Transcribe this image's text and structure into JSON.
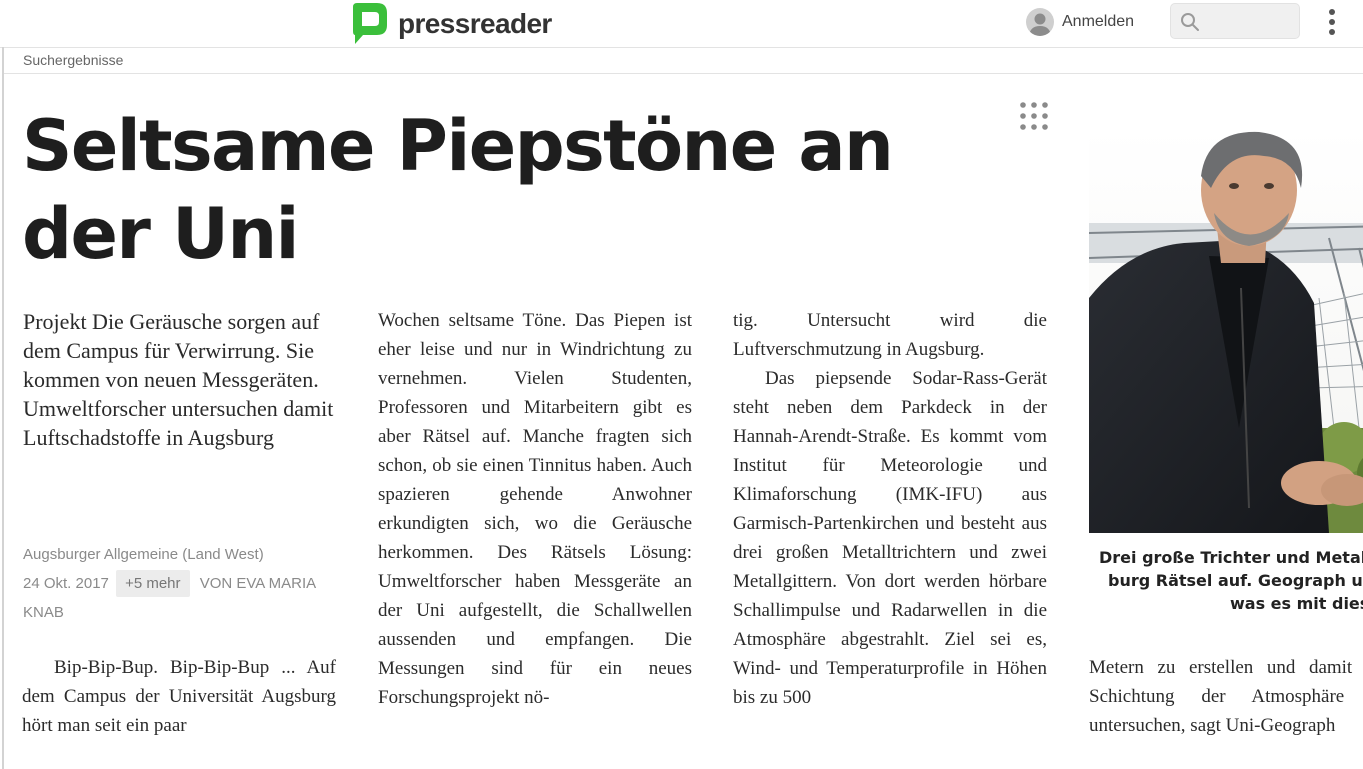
{
  "header": {
    "logo_text": "pressreader",
    "brand_color": "#3bbf3b",
    "signin_label": "Anmelden",
    "search_placeholder": ""
  },
  "breadcrumb": "Suchergebnisse",
  "article": {
    "headline": "Seltsame Piepstöne an der Uni",
    "lead": "Projekt Die Geräusche sorgen auf dem Campus für Verwirrung. Sie kommen von neuen Messgeräten. Umweltforscher untersuchen damit Luftschadstoffe in Augsburg",
    "publication": "Augsburger Allgemeine (Land West)",
    "date": "24 Okt. 2017",
    "more_label": "+5 mehr",
    "byline": "VON EVA MARIA KNAB",
    "col1": "Bip-Bip-Bup. Bip-Bip-Bup ... Auf dem Campus der Universität Augsburg hört man seit ein paar",
    "col2": "Wochen seltsame Töne. Das Piepen ist eher leise und nur in Windrichtung zu vernehmen. Vielen Studenten, Professoren und Mitarbeitern gibt es aber Rätsel auf. Manche fragten sich schon, ob sie einen Tinnitus haben. Auch spazieren gehende Anwohner erkundigten sich, wo die Geräusche herkommen. Des Rätsels Lösung: Umweltforscher haben Messgeräte an der Uni aufgestellt, die Schallwellen aussenden und empfangen. Die Messungen sind für ein neues Forschungsprojekt nö-",
    "col3_p1": "tig. Untersucht wird die Luftverschmutzung in Augsburg.",
    "col3_p2": "Das piepsende Sodar-Rass-Gerät steht neben dem Parkdeck in der Hannah-Arendt-Straße. Es kommt vom Institut für Meteorologie und Klimaforschung (IMK-IFU) aus Garmisch-Partenkirchen und besteht aus drei großen Metalltrichtern und zwei Metallgittern. Von dort werden hörbare Schallimpulse und Radarwellen in die Atmosphäre abgestrahlt. Ziel sei es, Wind- und Temperaturprofile in Höhen bis zu 500",
    "col4": "Metern zu erstellen und damit die Schichtung der Atmosphäre zu untersuchen, sagt Uni-Geograph",
    "caption_lines": [
      "Drei große Trichter und Metal",
      "burg Rätsel auf. Geograph un",
      "was es mit dies"
    ]
  }
}
